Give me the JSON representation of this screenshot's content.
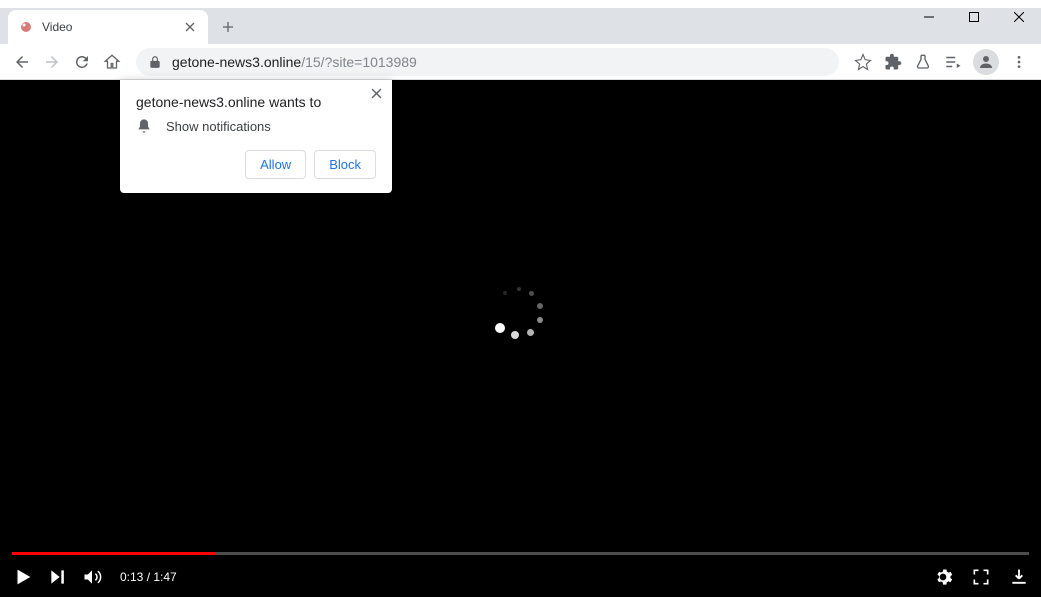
{
  "tab": {
    "title": "Video"
  },
  "url": {
    "domain": "getone-news3.online",
    "path": "/15/?site=1013989"
  },
  "notification": {
    "title": "getone-news3.online wants to",
    "body": "Show notifications",
    "allow": "Allow",
    "block": "Block"
  },
  "video": {
    "current_time": "0:13",
    "duration": "1:47",
    "progress_percent": 20
  }
}
